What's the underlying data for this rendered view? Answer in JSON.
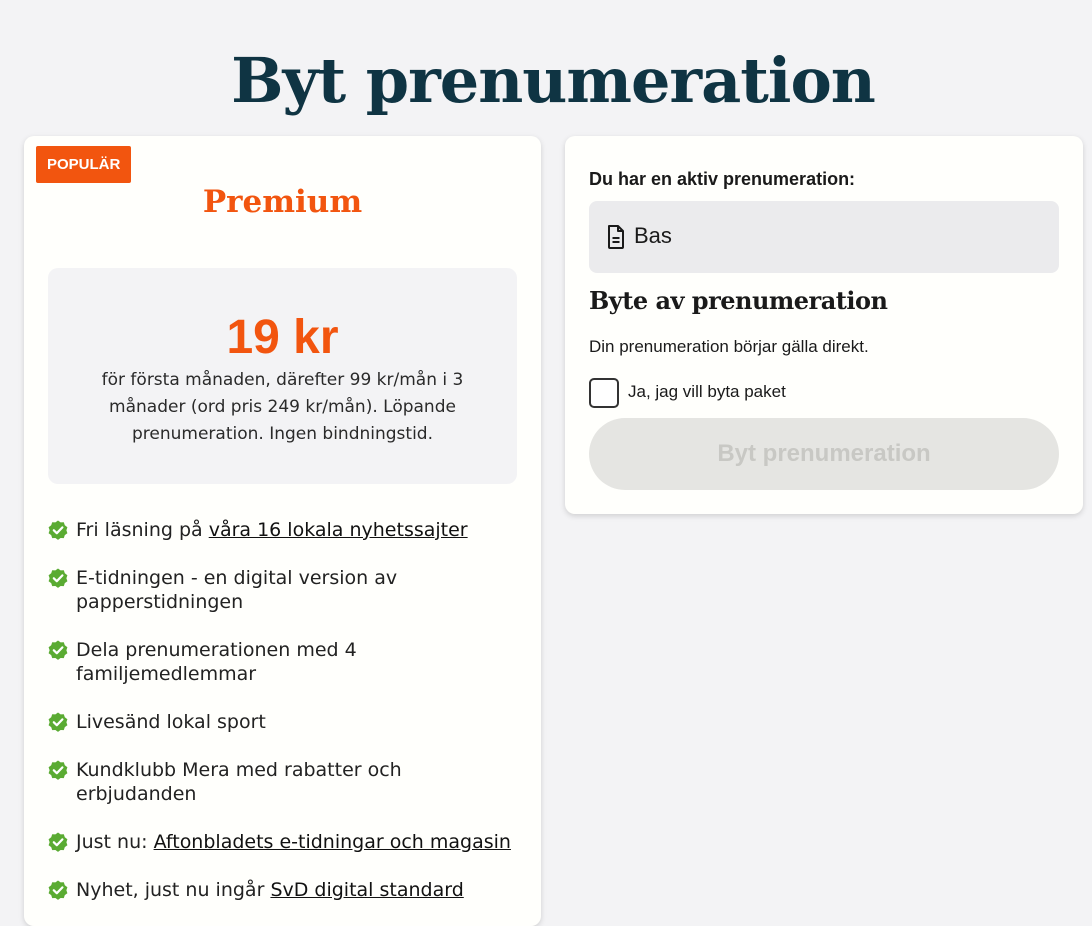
{
  "page": {
    "title": "Byt prenumeration"
  },
  "offer": {
    "badge": "POPULÄR",
    "plan_name": "Premium",
    "price": "19 kr",
    "price_description": "för första månaden, därefter 99 kr/mån i 3 månader (ord pris 249 kr/mån). Löpande prenumeration. Ingen bindningstid.",
    "features": [
      {
        "text": "Fri läsning på ",
        "link": "våra 16 lokala nyhetssajter"
      },
      {
        "text": "E-tidningen - en digital version av papperstidningen",
        "link": ""
      },
      {
        "text": "Dela prenumerationen med 4 familjemedlemmar",
        "link": ""
      },
      {
        "text": "Livesänd lokal sport",
        "link": ""
      },
      {
        "text": "Kundklubb Mera med rabatter och erbjudanden",
        "link": ""
      },
      {
        "text": "Just nu: ",
        "link": "Aftonbladets e-tidningar och magasin"
      },
      {
        "text": "Nyhet, just nu ingår ",
        "link": "SvD digital standard"
      }
    ],
    "check_icon_color": "#5aab32"
  },
  "current": {
    "label": "Du har en aktiv prenumeration:",
    "plan": "Bas",
    "icon": "document-icon"
  },
  "switch": {
    "heading": "Byte av prenumeration",
    "description": "Din prenumeration börjar gälla direkt.",
    "checkbox_label": "Ja, jag vill byta paket",
    "checkbox_checked": false,
    "button_label": "Byt prenumeration",
    "button_disabled": true
  },
  "colors": {
    "accent": "#f2550f",
    "title": "#0f3443",
    "check": "#5aab32"
  }
}
